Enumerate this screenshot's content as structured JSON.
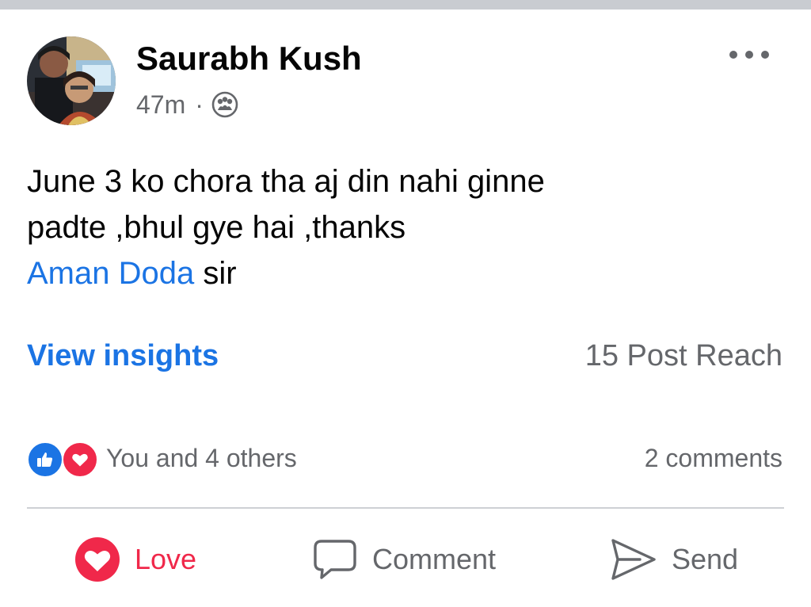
{
  "post": {
    "author": "Saurabh Kush",
    "time": "47m",
    "separator": "·",
    "audience_icon": "friends-icon",
    "more_icon": "more-horizontal-icon",
    "text_line1": "June 3 ko chora tha aj din nahi ginne",
    "text_line2": "padte ,bhul gye hai ,thanks",
    "mention": "Aman Doda",
    "text_after_mention": " sir"
  },
  "insights": {
    "view_label": "View insights",
    "reach_text": "15 Post Reach"
  },
  "engagement": {
    "reactions_text": "You and 4 others",
    "comments_text": "2 comments",
    "reaction_icons": [
      "like-icon",
      "love-icon"
    ]
  },
  "actions": {
    "love_label": "Love",
    "comment_label": "Comment",
    "send_label": "Send"
  },
  "colors": {
    "accent_blue": "#1b74e4",
    "love_red": "#f0284a",
    "secondary_text": "#65676b",
    "primary_text": "#050505",
    "divider": "#ced0d4"
  }
}
